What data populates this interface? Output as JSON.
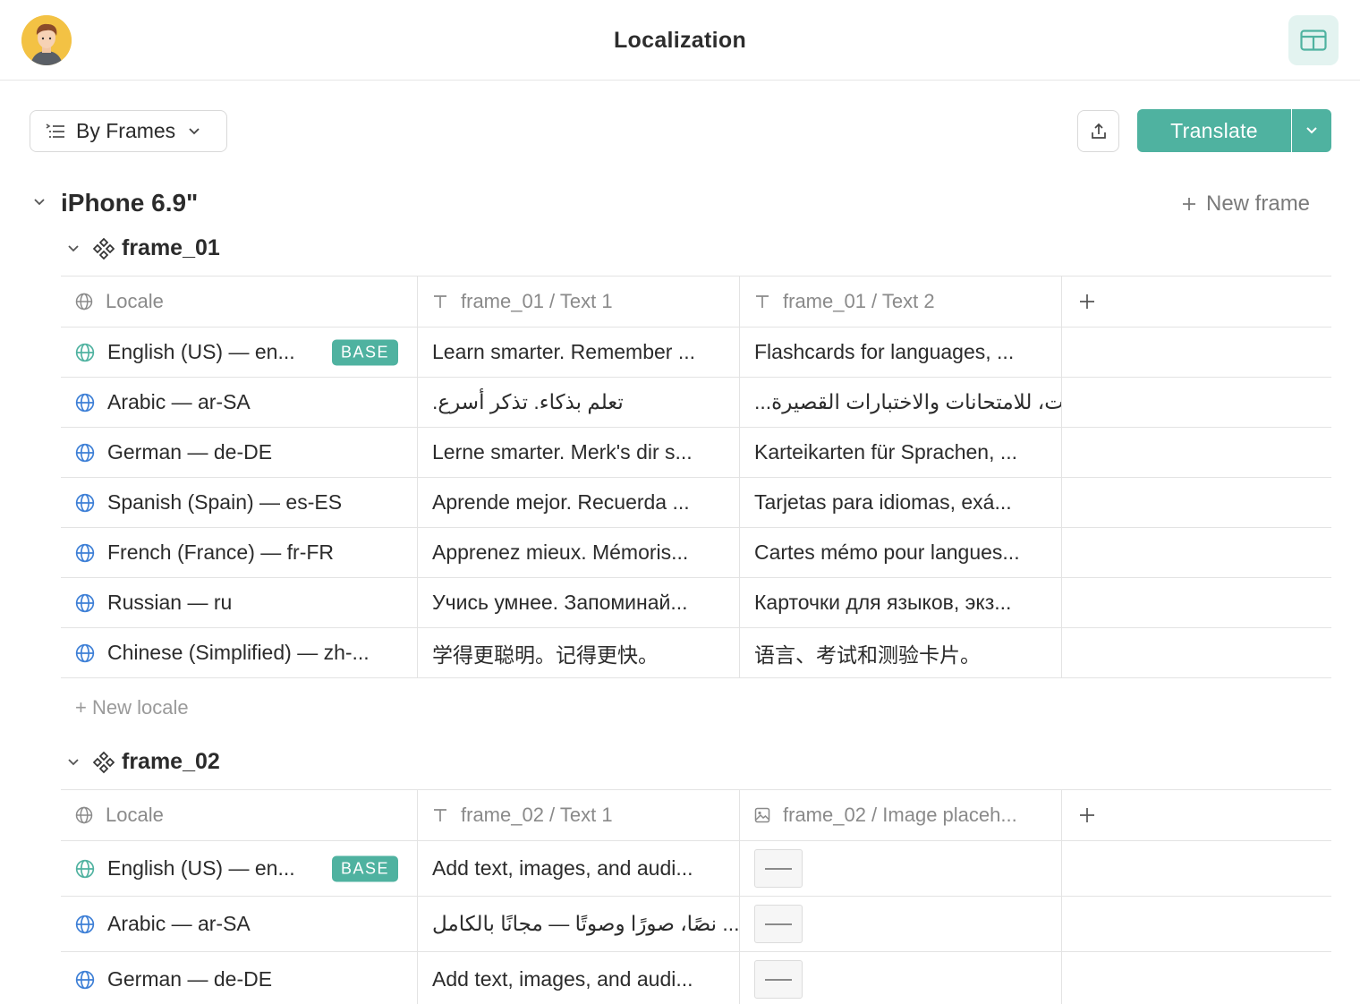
{
  "window": {
    "title": "Localization"
  },
  "toolbar": {
    "group_by": "By Frames",
    "translate_label": "Translate"
  },
  "device": {
    "name": "iPhone 6.9\"",
    "new_frame_label": "New frame"
  },
  "new_locale_label": "+ New locale",
  "frames": [
    {
      "name": "frame_01",
      "columns": [
        "Locale",
        "frame_01 / Text 1",
        "frame_01 / Text 2"
      ],
      "rows": [
        {
          "locale": "English (US) — en...",
          "badge": "BASE",
          "text1": "Learn smarter. Remember ...",
          "text2": "Flashcards for languages, ..."
        },
        {
          "locale": "Arabic — ar-SA",
          "text1": "تعلم بذكاء. تذكر أسرع.",
          "text2": "اللغات، للامتحانات والاختبارات القصيرة..."
        },
        {
          "locale": "German — de-DE",
          "text1": "Lerne smarter. Merk's dir s...",
          "text2": "Karteikarten für Sprachen, ..."
        },
        {
          "locale": "Spanish (Spain) — es-ES",
          "text1": "Aprende mejor. Recuerda ...",
          "text2": "Tarjetas para idiomas, exá..."
        },
        {
          "locale": "French (France) — fr-FR",
          "text1": "Apprenez mieux. Mémoris...",
          "text2": "Cartes mémo pour langues..."
        },
        {
          "locale": "Russian — ru",
          "text1": "Учись умнее.  Запоминай...",
          "text2": "Карточки для языков, экз..."
        },
        {
          "locale": "Chinese (Simplified) — zh-...",
          "text1": "学得更聪明。记得更快。",
          "text2": "语言、考试和测验卡片。"
        }
      ]
    },
    {
      "name": "frame_02",
      "columns": [
        "Locale",
        "frame_02 / Text 1",
        "frame_02 / Image placeh..."
      ],
      "rows": [
        {
          "locale": "English (US) — en...",
          "badge": "BASE",
          "text1": "Add text, images, and audi..."
        },
        {
          "locale": "Arabic — ar-SA",
          "text1": "... نصًا، صورًا وصوتًا — مجانًا بالكامل"
        },
        {
          "locale": "German — de-DE",
          "text1": "Add text, images, and audi..."
        }
      ]
    }
  ],
  "colors": {
    "accent": "#4fb2a0",
    "globe_base": "#4fb2a0",
    "globe": "#3d7fd6"
  }
}
